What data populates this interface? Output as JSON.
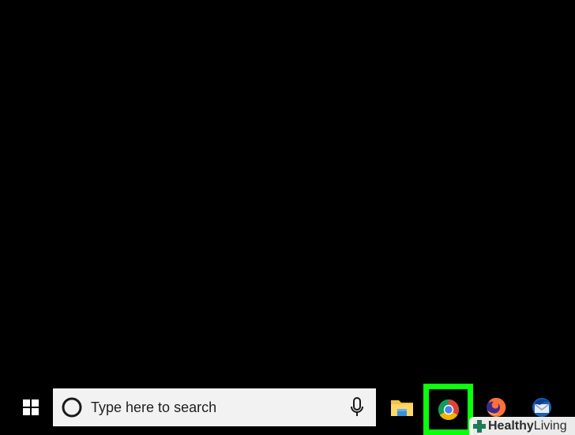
{
  "taskbar": {
    "search": {
      "placeholder": "Type here to search"
    },
    "apps": [
      {
        "name": "File Explorer",
        "icon": "folder-icon"
      },
      {
        "name": "Google Chrome",
        "icon": "chrome-icon",
        "highlighted": true
      },
      {
        "name": "Firefox",
        "icon": "firefox-icon"
      },
      {
        "name": "Thunderbird",
        "icon": "thunderbird-icon"
      }
    ]
  },
  "watermark": {
    "brand_bold": "Healthy",
    "brand_regular": " Living"
  },
  "colors": {
    "highlight": "#0aff0a",
    "desktop": "#000000",
    "search_bg": "#f2f2f2"
  }
}
